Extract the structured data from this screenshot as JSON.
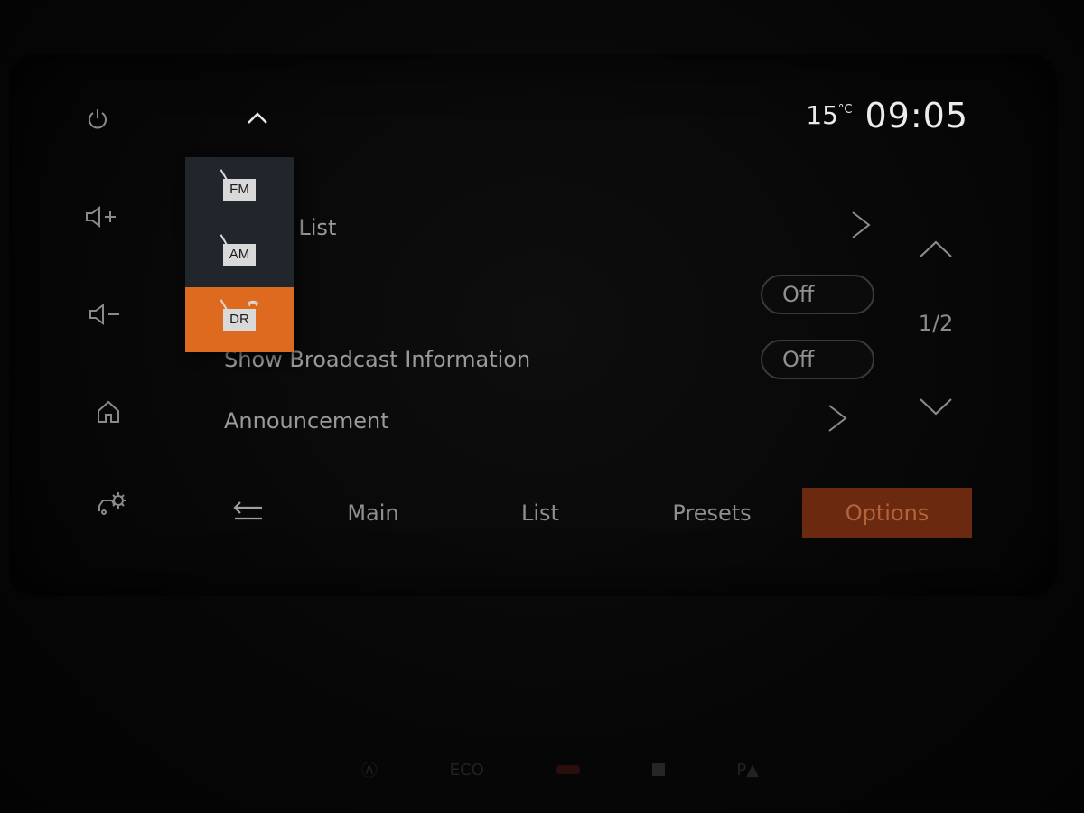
{
  "status": {
    "temperature": "15",
    "temperature_unit": "°C",
    "clock": "09:05"
  },
  "side_buttons": [
    {
      "name": "power-icon"
    },
    {
      "name": "volume-up-icon"
    },
    {
      "name": "volume-down-icon"
    },
    {
      "name": "home-icon"
    },
    {
      "name": "car-settings-icon"
    }
  ],
  "source_menu": {
    "items": [
      {
        "label": "FM",
        "active": false
      },
      {
        "label": "AM",
        "active": false
      },
      {
        "label": "DR",
        "active": true
      }
    ]
  },
  "options": {
    "rows": [
      {
        "label": "e List",
        "control": "chevron"
      },
      {
        "label": "",
        "control": "toggle",
        "value": "Off"
      },
      {
        "label": "Show Broadcast Information",
        "control": "toggle",
        "value": "Off"
      },
      {
        "label": "Announcement",
        "control": "chevron"
      }
    ]
  },
  "pager": {
    "text": "1/2"
  },
  "tabs": {
    "main": "Main",
    "list": "List",
    "presets": "Presets",
    "options": "Options"
  },
  "dash": {
    "eco": "ECO"
  },
  "colors": {
    "accent": "#de6a1f",
    "selected_tab": "#6b2a0f",
    "background": "#040404"
  }
}
